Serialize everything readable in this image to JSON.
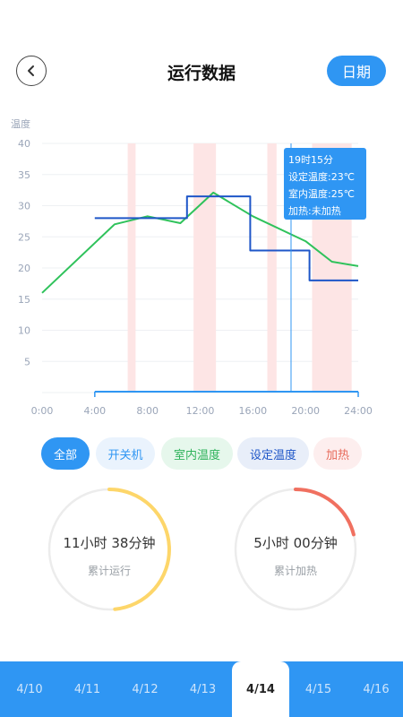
{
  "header": {
    "title": "运行数据",
    "date_button": "日期",
    "back_icon": "chevron-left-icon"
  },
  "chart_data": {
    "type": "line",
    "ylabel": "温度",
    "ylim": [
      0,
      40
    ],
    "yticks": [
      "5",
      "10",
      "15",
      "20",
      "25",
      "30",
      "35",
      "40"
    ],
    "xlim": [
      0,
      24
    ],
    "xticks": [
      "0:00",
      "4:00",
      "8:00",
      "12:00",
      "16:00",
      "20:00",
      "24:00"
    ],
    "grid": true,
    "heating_periods": [
      [
        6.5,
        7.1
      ],
      [
        11.5,
        13.2
      ],
      [
        17.1,
        17.8
      ],
      [
        20.5,
        23.5
      ]
    ],
    "series": [
      {
        "name": "室内温度",
        "color": "#2fc25b",
        "x": [
          0,
          5.5,
          8,
          10.5,
          13,
          16,
          20,
          22,
          24
        ],
        "y": [
          16,
          27,
          28.3,
          27.2,
          32.1,
          28.3,
          24.3,
          21,
          20.3
        ]
      },
      {
        "name": "设定温度",
        "color": "#1e56c8",
        "step": true,
        "x": [
          4,
          11,
          11,
          15.8,
          15.8,
          20.3,
          20.3,
          24
        ],
        "y": [
          28,
          28,
          31.5,
          31.5,
          22.8,
          22.8,
          18,
          18
        ]
      }
    ],
    "power_line": {
      "start": 4,
      "end": 24,
      "color": "#2f96f3"
    },
    "cursor_x": 18.9,
    "tooltip": {
      "lines": [
        "19时15分",
        "设定温度:23℃",
        "室内温度:25℃",
        "加热:未加热"
      ],
      "bg": "#2f96f3"
    },
    "colors": {
      "heating_band": "#fde5e5",
      "grid": "#eef0f3",
      "axis_text": "#9aa5b8"
    }
  },
  "filters": [
    {
      "label": "全部",
      "bg": "#2f96f3",
      "color": "#ffffff"
    },
    {
      "label": "开关机",
      "bg": "#eaf3fd",
      "color": "#2f96f3"
    },
    {
      "label": "室内温度",
      "bg": "#e6f7ec",
      "color": "#2fb35b"
    },
    {
      "label": "设定温度",
      "bg": "#e8eef9",
      "color": "#1e56c8"
    },
    {
      "label": "加热",
      "bg": "#fdeeee",
      "color": "#e86a5a"
    }
  ],
  "stats": [
    {
      "value": "11小时 38分钟",
      "caption": "累计运行",
      "fraction": 0.485,
      "color": "#fdd66a"
    },
    {
      "value": "5小时 00分钟",
      "caption": "累计加热",
      "fraction": 0.21,
      "color": "#f07060"
    }
  ],
  "dates": {
    "items": [
      "4/10",
      "4/11",
      "4/12",
      "4/13",
      "4/14",
      "4/15",
      "4/16"
    ],
    "selected": "4/14"
  }
}
